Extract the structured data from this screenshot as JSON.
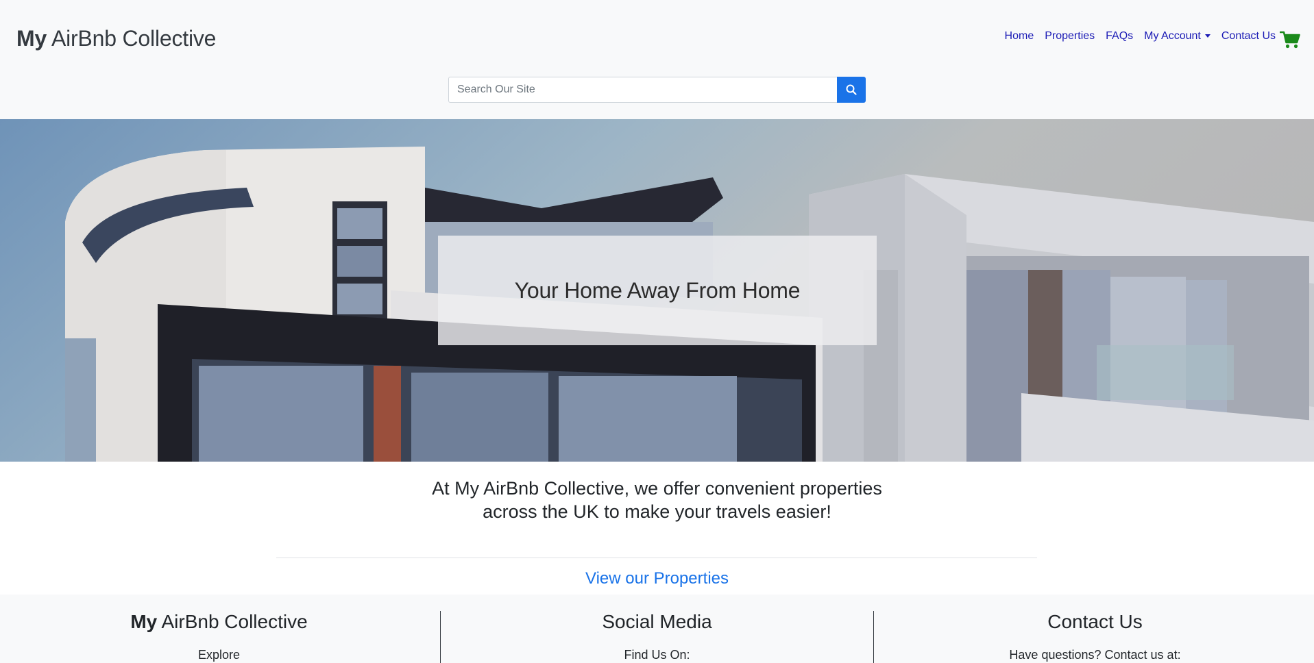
{
  "header": {
    "brand_bold": "My",
    "brand_rest": " AirBnb Collective",
    "nav": {
      "home": "Home",
      "properties": "Properties",
      "faqs": "FAQs",
      "account": "My Account",
      "contact": "Contact Us"
    },
    "cart_icon": "shopping-cart-icon",
    "search": {
      "placeholder": "Search Our Site",
      "value": "",
      "icon": "search-icon"
    }
  },
  "hero": {
    "title": "Your Home Away From Home"
  },
  "intro": {
    "text": "At My AirBnb Collective, we offer convenient properties across the UK to make your travels easier!",
    "link": "View our Properties"
  },
  "footer": {
    "col1": {
      "title_bold": "My",
      "title_rest": " AirBnb Collective",
      "text": "Explore"
    },
    "col2": {
      "title": "Social Media",
      "text": "Find Us On:"
    },
    "col3": {
      "title": "Contact Us",
      "text": "Have questions? Contact us at:"
    }
  },
  "colors": {
    "nav_link": "#1a1ab5",
    "accent": "#1a73e8",
    "cart": "#1b8a1b",
    "header_bg": "#f8f9fa"
  }
}
